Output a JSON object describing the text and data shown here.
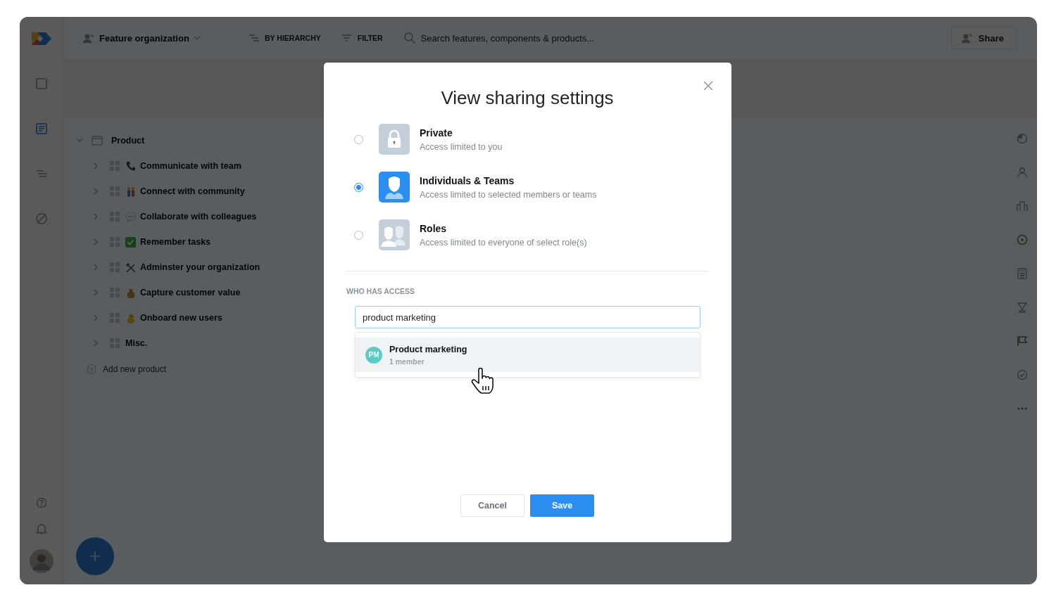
{
  "app": {
    "view_title": "Feature organization",
    "toolbar": [
      {
        "label": "BY HIERARCHY",
        "kind": "hierarchy"
      },
      {
        "label": "FILTER",
        "kind": "filter"
      }
    ],
    "search": {
      "placeholder": "Search features, components & products..."
    },
    "share_button": "Share",
    "nav_items": [
      {
        "kind": "board",
        "selected": false
      },
      {
        "kind": "list",
        "selected": true
      },
      {
        "kind": "roadmap",
        "selected": false
      },
      {
        "kind": "insights",
        "selected": false
      }
    ],
    "tree": {
      "label": "Product",
      "expanded": true,
      "children": [
        {
          "label": "Communicate with team",
          "kind": "phone",
          "expanded": false
        },
        {
          "label": "Connect with community",
          "kind": "people",
          "expanded": false
        },
        {
          "label": "Collaborate with colleagues",
          "kind": "speech",
          "expanded": false
        },
        {
          "label": "Remember tasks",
          "kind": "check",
          "expanded": false
        },
        {
          "label": "Adminster your organization",
          "kind": "tools",
          "expanded": false
        },
        {
          "label": "Capture customer value",
          "kind": "moneybag",
          "expanded": false
        },
        {
          "label": "Onboard new users",
          "kind": "chick",
          "expanded": false
        },
        {
          "label": "Misc.",
          "kind": "plain",
          "expanded": false
        }
      ]
    },
    "add_product": "Add new product"
  },
  "dialog": {
    "title": "View sharing settings",
    "options": [
      {
        "kind": "private",
        "title": "Private",
        "description": "Access limited to you",
        "selected": false
      },
      {
        "kind": "individuals",
        "title": "Individuals & Teams",
        "description": "Access limited to selected members or teams",
        "selected": true
      },
      {
        "kind": "roles",
        "title": "Roles",
        "description": "Access limited to everyone of select role(s)",
        "selected": false
      }
    ],
    "section_label": "WHO HAS ACCESS",
    "search": {
      "value": "product marketing"
    },
    "results": [
      {
        "initials": "PM",
        "name": "Product marketing",
        "detail": "1 member",
        "color": "#5bcbc5",
        "selected": true
      }
    ],
    "buttons": [
      {
        "label": "Cancel",
        "kind": "secondary"
      },
      {
        "label": "Save",
        "kind": "primary"
      }
    ]
  }
}
